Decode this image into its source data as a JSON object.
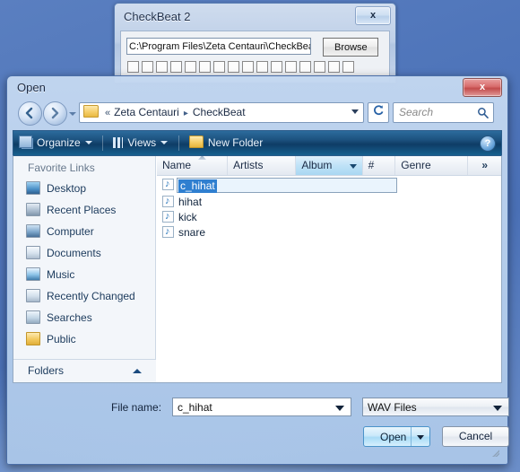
{
  "background_window": {
    "title": "CheckBeat 2",
    "close_label": "x",
    "path_value": "C:\\Program Files\\Zeta Centauri\\CheckBea",
    "browse_label": "Browse",
    "checkbox_count": 16
  },
  "dialog": {
    "title": "Open",
    "close_label": "x",
    "address": {
      "chevrons": "«",
      "crumbs": [
        "Zeta Centauri",
        "CheckBeat"
      ],
      "separator": "▸",
      "folder_icon": "folder-icon",
      "dropdown_icon": "chevron-down-icon"
    },
    "refresh_icon": "refresh-icon",
    "search": {
      "placeholder": "Search",
      "value": "",
      "icon": "search-icon"
    },
    "toolbar": {
      "organize_label": "Organize",
      "views_label": "Views",
      "new_folder_label": "New Folder",
      "help_label": "?"
    },
    "sidebar": {
      "header": "Favorite Links",
      "items": [
        {
          "label": "Desktop",
          "icon": "desktop-icon"
        },
        {
          "label": "Recent Places",
          "icon": "recent-places-icon"
        },
        {
          "label": "Computer",
          "icon": "computer-icon"
        },
        {
          "label": "Documents",
          "icon": "documents-icon"
        },
        {
          "label": "Music",
          "icon": "music-icon"
        },
        {
          "label": "Recently Changed",
          "icon": "recently-changed-icon"
        },
        {
          "label": "Searches",
          "icon": "searches-icon"
        },
        {
          "label": "Public",
          "icon": "public-folder-icon"
        }
      ],
      "folders_label": "Folders",
      "folders_caret_icon": "chevron-up-icon"
    },
    "filelist": {
      "columns": [
        {
          "label": "Name",
          "sorted": true
        },
        {
          "label": "Artists",
          "sorted": false
        },
        {
          "label": "Album",
          "sorted": false,
          "active": true
        },
        {
          "label": "#",
          "sorted": false
        },
        {
          "label": "Genre",
          "sorted": false
        },
        {
          "label": "»",
          "sorted": false
        }
      ],
      "rows": [
        {
          "name": "c_hihat",
          "icon": "music-note-icon",
          "renaming": true,
          "selected_text": "c_hihat"
        },
        {
          "name": "hihat",
          "icon": "music-note-icon",
          "renaming": false
        },
        {
          "name": "kick",
          "icon": "music-note-icon",
          "renaming": false
        },
        {
          "name": "snare",
          "icon": "music-note-icon",
          "renaming": false
        }
      ]
    },
    "bottom": {
      "filename_label": "File name:",
      "filename_value": "c_hihat",
      "filetype_value": "WAV Files",
      "open_label": "Open",
      "cancel_label": "Cancel"
    }
  },
  "colors": {
    "desktop": "#4f75ba",
    "toolbar_blue": "#1d5380",
    "selection_blue": "#2f7fd0",
    "close_red": "#c24b4b",
    "accent_link": "#1b3a5c"
  }
}
